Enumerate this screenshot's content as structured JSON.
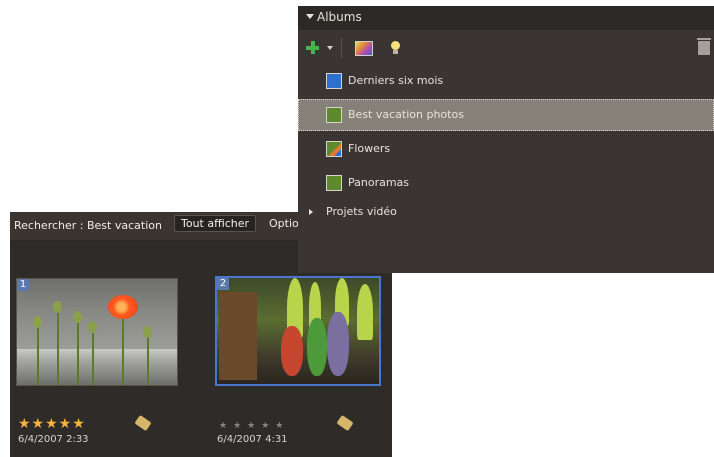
{
  "browser": {
    "search_label": "Rechercher : Best vacation",
    "show_all_label": "Tout afficher",
    "options_label": "Optio",
    "thumbnails": [
      {
        "number": "1",
        "rating": 5,
        "date": "6/4/2007 2:33",
        "selected": false
      },
      {
        "number": "2",
        "rating": 0,
        "date": "6/4/2007 4:31",
        "selected": true
      }
    ]
  },
  "albums": {
    "title": "Albums",
    "toolbar": {
      "add_icon": "plus-icon",
      "edit_icon": "edit-icon",
      "idea_icon": "lightbulb-icon",
      "delete_icon": "trash-icon"
    },
    "items": [
      {
        "label": "Derniers six mois",
        "icon_color": "#2f6fd0",
        "selected": false
      },
      {
        "label": "Best vacation photos",
        "icon_color": "#5e8a2d",
        "selected": true
      },
      {
        "label": "Flowers",
        "icon_color": "#5e8a2d",
        "selected": false
      },
      {
        "label": "Panoramas",
        "icon_color": "#5e8a2d",
        "selected": false
      }
    ],
    "group": {
      "label": "Projets vidéo"
    }
  },
  "colors": {
    "panel_bg": "#3a3532",
    "selected_row": "#858078",
    "selection_blue": "#4b76d0",
    "star": "#f4b43c",
    "add_green": "#48b34a"
  }
}
